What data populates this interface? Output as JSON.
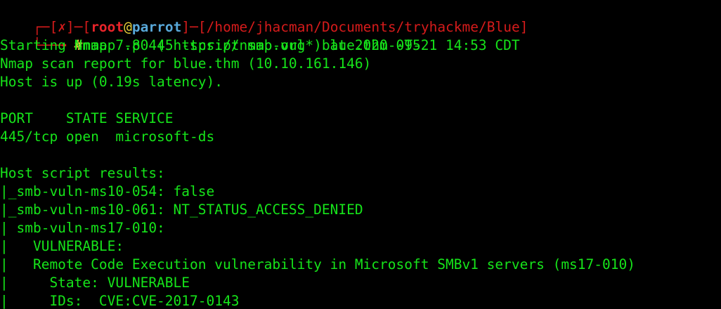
{
  "prompt": {
    "open_bracket_left": "┌─[",
    "status": "✗",
    "close_bracket_1": "]─[",
    "user": "root",
    "at": "@",
    "host": "parrot",
    "close_bracket_2": "]─[",
    "path": "/home/jhacman/Documents/tryhackme/Blue",
    "close_bracket_3": "]",
    "corner": "└──╼ ",
    "symbol": "#",
    "command": "nmap -p 445 -script smb-vul* blue.thm -T5"
  },
  "output": [
    "Starting Nmap 7.80 ( https://nmap.org ) at 2020-09-21 14:53 CDT",
    "Nmap scan report for blue.thm (10.10.161.146)",
    "Host is up (0.19s latency).",
    "",
    "PORT    STATE SERVICE",
    "445/tcp open  microsoft-ds",
    "",
    "Host script results:",
    "|_smb-vuln-ms10-054: false",
    "|_smb-vuln-ms10-061: NT_STATUS_ACCESS_DENIED",
    "| smb-vuln-ms17-010:",
    "|   VULNERABLE:",
    "|   Remote Code Execution vulnerability in Microsoft SMBv1 servers (ms17-010)",
    "|     State: VULNERABLE",
    "|     IDs:  CVE:CVE-2017-0143"
  ],
  "colors": {
    "background": "#000000",
    "text": "#16e41a",
    "prompt_red": "#d51b1b",
    "prompt_yellow": "#e7cf3a",
    "host_blue": "#58a8d9"
  }
}
